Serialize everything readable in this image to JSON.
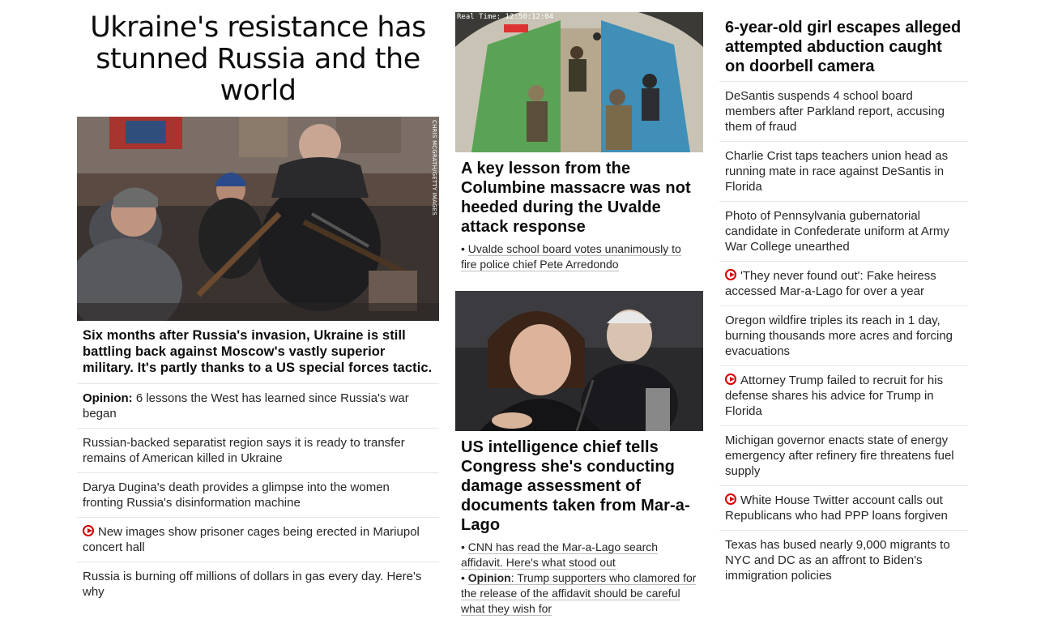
{
  "left": {
    "headline": "Ukraine's resistance has stunned Russia and the world",
    "photo_credit": "CHRIS MCGRATH/GETTY IMAGES",
    "lead_summary": "Six months after Russia's invasion, Ukraine is still battling back against Moscow's vastly superior military. It's partly thanks to a US special forces tactic.",
    "items": [
      {
        "prefix": "Opinion:",
        "text": " 6 lessons the West has learned since Russia's war began",
        "video": false
      },
      {
        "prefix": "",
        "text": "Russian-backed separatist region says it is ready to transfer remains of American killed in Ukraine",
        "video": false
      },
      {
        "prefix": "",
        "text": "Darya Dugina's death provides a glimpse into the women fronting Russia's disinformation machine",
        "video": false
      },
      {
        "prefix": "",
        "text": "New images show prisoner cages being erected in Mariupol concert hall",
        "video": true
      },
      {
        "prefix": "",
        "text": "Russia is burning off millions of dollars in gas every day. Here's why",
        "video": false
      }
    ]
  },
  "middle": {
    "story1": {
      "timestamp": "Real Time: 12:50:12:04",
      "headline": "A key lesson from the Columbine massacre was not heeded during the Uvalde attack response",
      "link": "Uvalde school board votes unanimously to fire police chief Pete Arredondo"
    },
    "story2": {
      "headline": "US intelligence chief tells Congress she's conducting damage assessment of documents taken from Mar-a-Lago",
      "link1": "CNN has read the Mar-a-Lago search affidavit. Here's what stood out",
      "link2_prefix": "Opinion",
      "link2": ": Trump supporters who clamored for the release of the affidavit should be careful what they wish for"
    }
  },
  "right": {
    "headline": "6-year-old girl escapes alleged attempted abduction caught on doorbell camera",
    "items": [
      {
        "text": "DeSantis suspends 4 school board members after Parkland report, accusing them of fraud",
        "video": false
      },
      {
        "text": "Charlie Crist taps teachers union head as running mate in race against DeSantis in Florida",
        "video": false
      },
      {
        "text": "Photo of Pennsylvania gubernatorial candidate in Confederate uniform at Army War College unearthed",
        "video": false
      },
      {
        "text": "'They never found out': Fake heiress accessed Mar-a-Lago for over a year",
        "video": true
      },
      {
        "text": "Oregon wildfire triples its reach in 1 day, burning thousands more acres and forcing evacuations",
        "video": false
      },
      {
        "text": "Attorney Trump failed to recruit for his defense shares his advice for Trump in Florida",
        "video": true
      },
      {
        "text": "Michigan governor enacts state of energy emergency after refinery fire threatens fuel supply",
        "video": false
      },
      {
        "text": "White House Twitter account calls out Republicans who had PPP loans forgiven",
        "video": true
      },
      {
        "text": "Texas has bused nearly 9,000 migrants to NYC and DC as an affront to Biden's immigration policies",
        "video": false
      }
    ]
  },
  "colors": {
    "video_red": "#cc0000",
    "divider": "#e6e6e6",
    "text": "#0c0c0c"
  }
}
